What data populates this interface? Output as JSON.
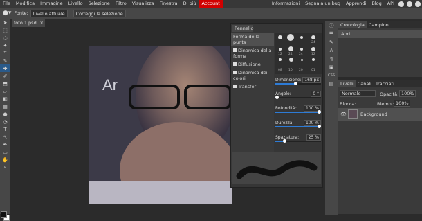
{
  "menu": [
    "File",
    "Modifica",
    "Immagine",
    "Livello",
    "Selezione",
    "Filtro",
    "Visualizza",
    "Finestra",
    "Di più",
    "Account"
  ],
  "menu_right": [
    "Informazioni",
    "Segnala un bug",
    "Apprendi",
    "Blog",
    "API"
  ],
  "options": {
    "fonte_label": "Fonte:",
    "fonte_value": "Livello attuale",
    "correct_btn": "Correggi la selezione"
  },
  "document_tab": "foto 1.psd",
  "canvas_text": "Ar",
  "brush_panel": {
    "tab": "Pennello",
    "sections": [
      "Forma della punta",
      "Dinamica della forma",
      "Diffusione",
      "Dinamica dei colori",
      "Transfer"
    ],
    "brush_sizes": [
      "24",
      "12",
      "24",
      "24",
      "12",
      "24",
      "24",
      "24",
      "08",
      "10",
      "20",
      "01"
    ],
    "params": [
      {
        "label": "Dimensione:",
        "value": "168  px",
        "fill": 0.45
      },
      {
        "label": "Angolo:",
        "value": "0 °",
        "fill": 0.02
      },
      {
        "label": "Rotondità:",
        "value": "100 %",
        "fill": 1.0
      },
      {
        "label": "Durezza:",
        "value": "100 %",
        "fill": 1.0
      },
      {
        "label": "Spaziatura:",
        "value": "25 %",
        "fill": 0.2
      }
    ]
  },
  "history_panel": {
    "tabs": [
      "Cronologia",
      "Campioni"
    ],
    "items": [
      "Apri"
    ]
  },
  "layers_panel": {
    "tabs": [
      "Livelli",
      "Canali",
      "Tracciati"
    ],
    "blend_mode": "Normale",
    "opacity_label": "Opacità:",
    "opacity_value": "100%",
    "lock_label": "Blocca:",
    "fill_label": "Riempi:",
    "fill_value": "100%",
    "layers": [
      {
        "name": "Background"
      }
    ]
  },
  "colors": {
    "accent": "#2d7bd6",
    "account": "#d10000",
    "foreground": "#111111",
    "background": "#ffffff"
  }
}
